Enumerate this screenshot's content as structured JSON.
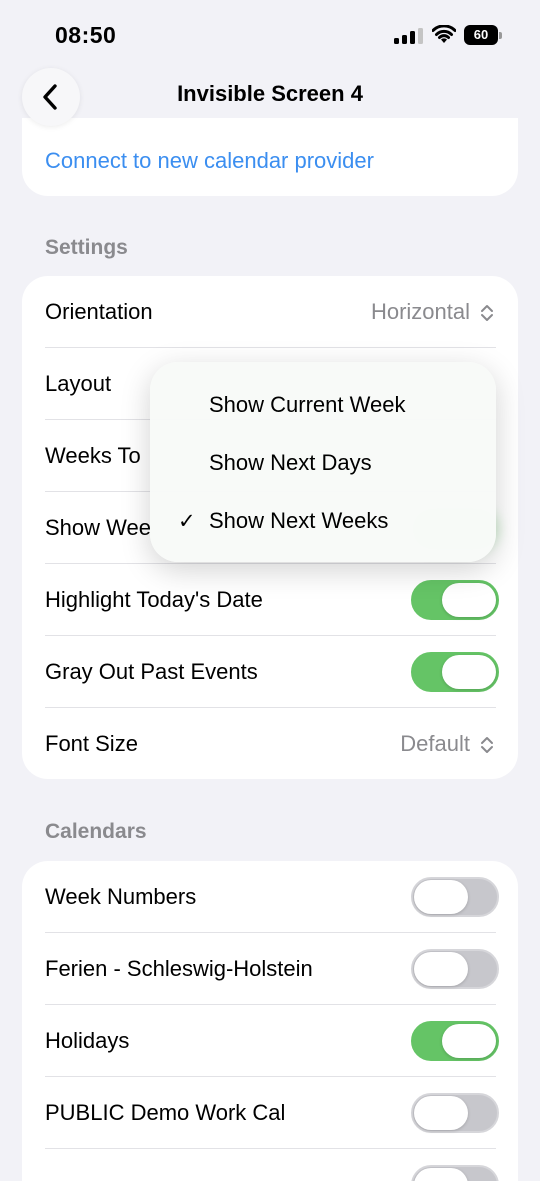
{
  "status": {
    "time": "08:50",
    "battery": "60"
  },
  "nav": {
    "title": "Invisible Screen 4"
  },
  "top_card": {
    "link": "Connect to new calendar provider"
  },
  "settings": {
    "header": "Settings",
    "orientation": {
      "label": "Orientation",
      "value": "Horizontal"
    },
    "layout": {
      "label": "Layout"
    },
    "weeks_to": {
      "label": "Weeks To"
    },
    "show_week": {
      "label": "Show Wee"
    },
    "highlight_today": {
      "label": "Highlight Today's Date",
      "on": true
    },
    "gray_out_past": {
      "label": "Gray Out Past Events",
      "on": true
    },
    "font_size": {
      "label": "Font Size",
      "value": "Default"
    }
  },
  "layout_menu": {
    "options": [
      "Show Current Week",
      "Show Next Days",
      "Show Next Weeks"
    ],
    "selected": "Show Next Weeks",
    "check": "✓"
  },
  "calendars": {
    "header": "Calendars",
    "items": [
      {
        "label": "Week Numbers",
        "on": false
      },
      {
        "label": "Ferien - Schleswig-Holstein",
        "on": false
      },
      {
        "label": "Holidays",
        "on": true
      },
      {
        "label": "PUBLIC Demo Work Cal",
        "on": false
      }
    ]
  },
  "colors": {
    "accent": "#3b8ef0",
    "toggle_on": "#65c466",
    "toggle_off": "#c7c7cc",
    "background": "#f2f2f7"
  }
}
